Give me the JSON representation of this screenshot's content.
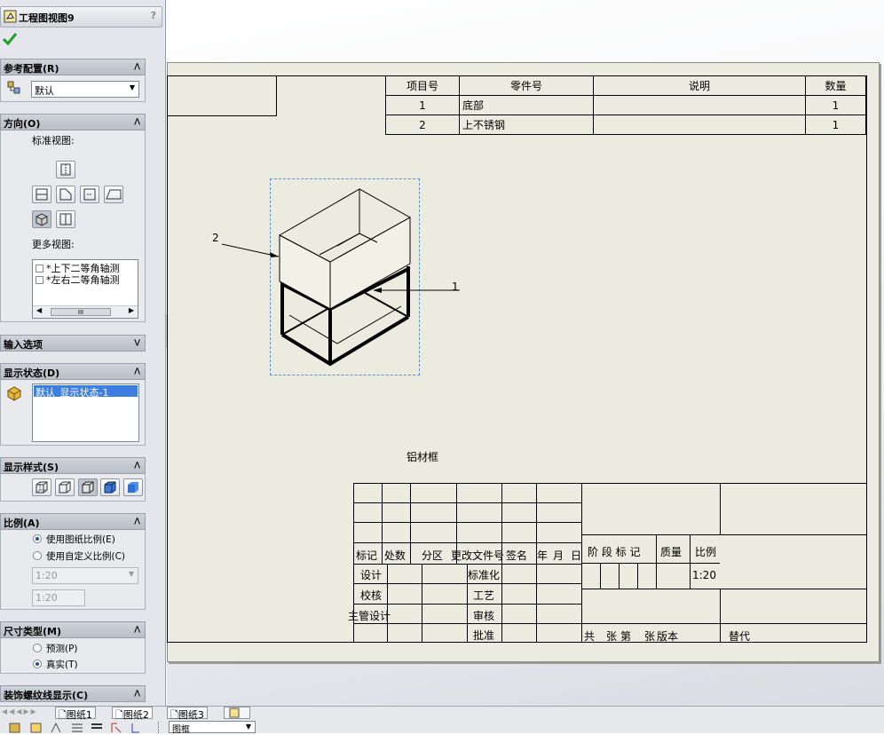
{
  "panel": {
    "title": "工程图视图9",
    "help": "?",
    "ref_config": {
      "header": "参考配置(R)",
      "value": "默认"
    },
    "orientation": {
      "header": "方向(O)",
      "standard_views_label": "标准视图:",
      "more_views_label": "更多视图:",
      "more_views": [
        "*上下二等角轴测",
        "*左右二等角轴测"
      ],
      "scroll_thumb": "III"
    },
    "import_options": {
      "header": "输入选项"
    },
    "display_state": {
      "header": "显示状态(D)",
      "item": "默认_显示状态-1"
    },
    "display_style": {
      "header": "显示样式(S)"
    },
    "scale": {
      "header": "比例(A)",
      "opt1": "使用图纸比例(E)",
      "opt2": "使用自定义比例(C)",
      "selected": "opt1",
      "combo": "1:20",
      "field": "1:20"
    },
    "dimension_type": {
      "header": "尺寸类型(M)",
      "opt1": "预测(P)",
      "opt2": "真实(T)",
      "selected": "opt2"
    },
    "cosmetic_thread": {
      "header": "装饰螺纹线显示(C)"
    }
  },
  "bom": {
    "headers": [
      "项目号",
      "零件号",
      "说明",
      "数量"
    ],
    "rows": [
      [
        "1",
        "底部",
        "",
        "1"
      ],
      [
        "2",
        "上不锈钢",
        "",
        "1"
      ]
    ]
  },
  "drawing": {
    "balloon1": "1",
    "balloon2": "2",
    "caption": "铝材框"
  },
  "title_block": {
    "row_labels": [
      "标记",
      "处数",
      "分区",
      "更改文件号",
      "签名",
      "年",
      "月",
      "日"
    ],
    "left_labels": [
      "设计",
      "校核",
      "主管设计"
    ],
    "mid_labels": [
      "标准化",
      "工艺",
      "审核",
      "批准"
    ],
    "stage": "阶 段 标 记",
    "mass": "质量",
    "scale_label": "比例",
    "scale_value": "1:20",
    "total": "共",
    "sheet_unit": "张",
    "sheet_no": "第",
    "sheet_unit2": "张",
    "version": "版本",
    "replace": "替代"
  },
  "sheets": {
    "tabs": [
      "图纸1",
      "图纸2",
      "图纸3"
    ],
    "active": 1
  },
  "toolbar": {
    "combo": "图框"
  }
}
